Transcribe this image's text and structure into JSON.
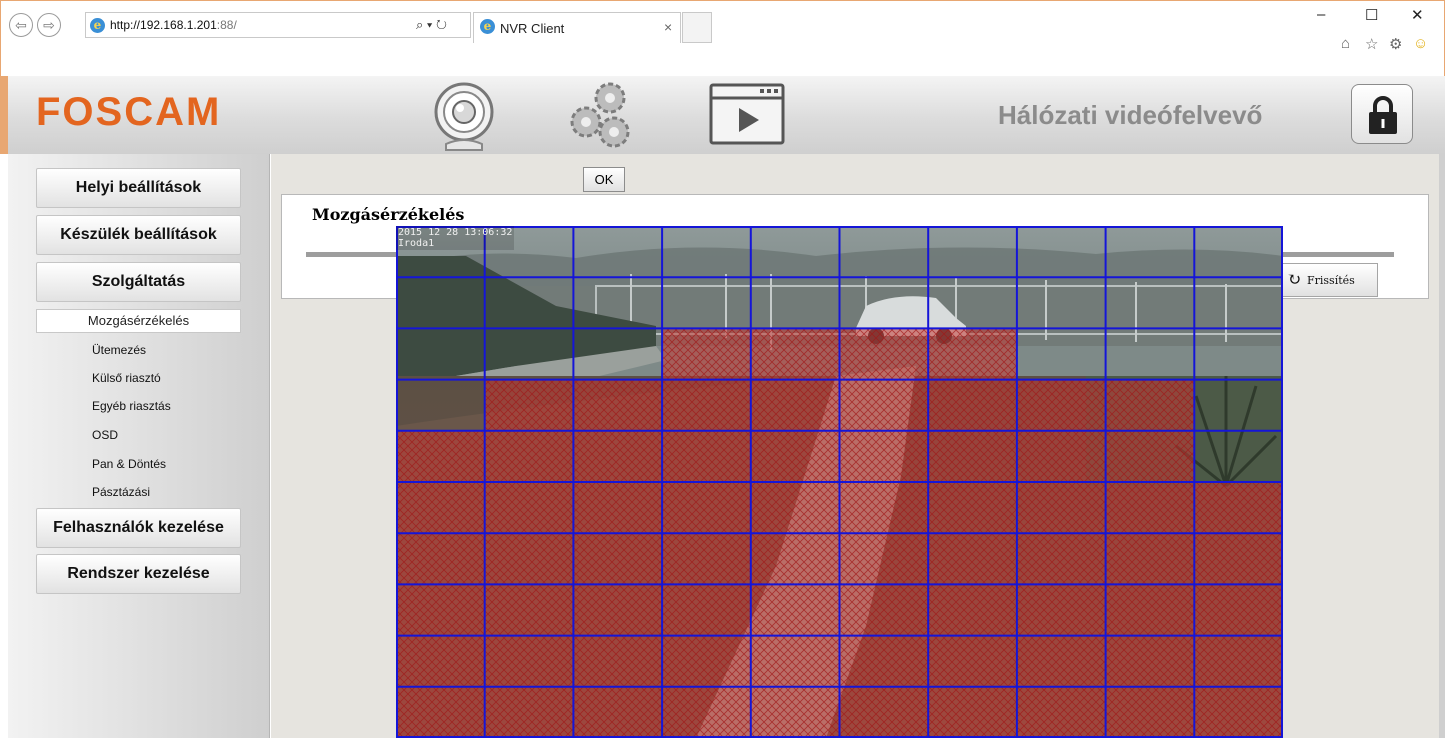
{
  "browser": {
    "url_host": "http://192.168.1.201",
    "url_port": ":88/",
    "tab_title": "NVR Client",
    "tab_close": "×",
    "search_glyph": "⌕ ▾ ↻",
    "minimize": "–",
    "maximize": "☐",
    "close": "✕",
    "tools": [
      "home-icon",
      "star-icon",
      "gear-icon",
      "smiley-icon"
    ]
  },
  "header": {
    "logo": "FOSCAM",
    "title": "Hálózati videófelvevő",
    "icons": [
      "camera-icon",
      "settings-gears-icon",
      "playback-icon",
      "lock-icon"
    ]
  },
  "sidebar": {
    "local_settings": "Helyi beállítások",
    "device_settings": "Készülék beállítások",
    "service": "Szolgáltatás",
    "selected_sub": "Mozgásérzékelés",
    "sub_items": [
      "Ütemezés",
      "Külső riasztó",
      "Egyéb riasztás",
      "OSD",
      "Pan & Döntés",
      "Pásztázási"
    ],
    "user_management": "Felhasználók kezelése",
    "system_management": "Rendszer kezelése"
  },
  "main": {
    "ok_label": "OK",
    "panel_title": "Mozgásérzékelés",
    "refresh_label": "Frissítés"
  },
  "video": {
    "timestamp": "2015 12 28 13:06:32",
    "channel_name": "Iroda1",
    "grid_columns": 10,
    "grid_rows": 10,
    "grid_color": "#1515d8",
    "active_area_color": "#c43a34",
    "active_cells": [
      [
        0,
        0,
        0,
        0,
        0,
        0,
        0,
        0,
        0,
        0
      ],
      [
        0,
        0,
        0,
        0,
        0,
        0,
        0,
        0,
        0,
        0
      ],
      [
        0,
        0,
        0,
        1,
        1,
        1,
        1,
        0,
        0,
        0
      ],
      [
        0,
        1,
        1,
        1,
        1,
        1,
        1,
        1,
        1,
        0
      ],
      [
        1,
        1,
        1,
        1,
        1,
        1,
        1,
        1,
        1,
        0
      ],
      [
        1,
        1,
        1,
        1,
        1,
        1,
        1,
        1,
        1,
        1
      ],
      [
        1,
        1,
        1,
        1,
        1,
        1,
        1,
        1,
        1,
        1
      ],
      [
        1,
        1,
        1,
        1,
        1,
        1,
        1,
        1,
        1,
        1
      ],
      [
        1,
        1,
        1,
        1,
        1,
        1,
        1,
        1,
        1,
        1
      ],
      [
        1,
        1,
        1,
        1,
        1,
        1,
        1,
        1,
        1,
        1
      ]
    ]
  },
  "colors": {
    "brand_orange": "#e3651f",
    "window_border": "#e8a772",
    "header_title": "#8b8b8b"
  }
}
